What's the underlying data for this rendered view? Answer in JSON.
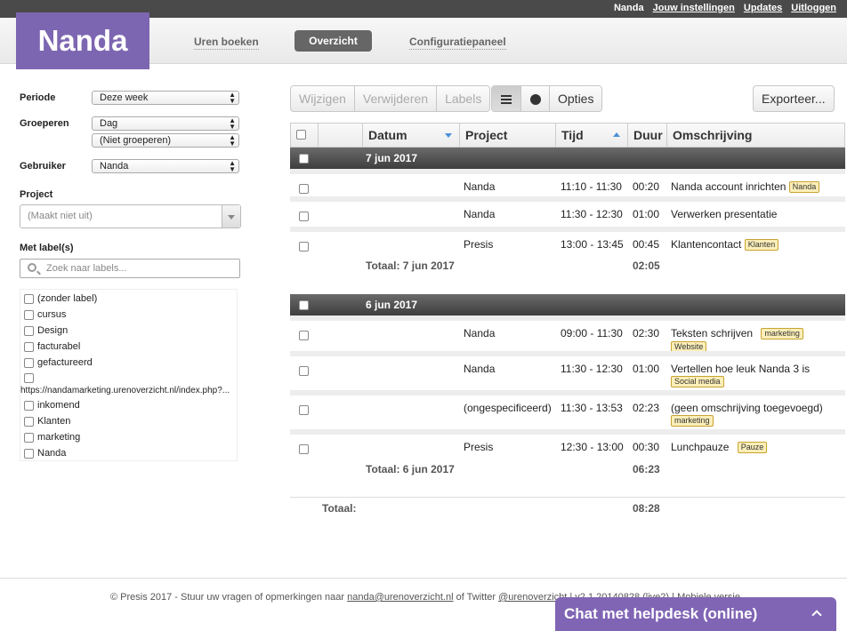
{
  "topbar": {
    "user": "Nanda",
    "settings": "Jouw instellingen",
    "updates": "Updates",
    "logout": "Uitloggen"
  },
  "header": {
    "logo": "Nanda",
    "tabs": [
      "Uren boeken",
      "Overzicht",
      "Configuratiepaneel"
    ],
    "active_tab": "Overzicht"
  },
  "sidebar": {
    "periode_label": "Periode",
    "periode_value": "Deze week",
    "groeperen_label": "Groeperen",
    "groeperen_value": "Dag",
    "groeperen_value2": "(Niet groeperen)",
    "gebruiker_label": "Gebruiker",
    "gebruiker_value": "Nanda",
    "project_label": "Project",
    "project_placeholder": "(Maakt niet uit)",
    "labels_label": "Met label(s)",
    "labels_search_placeholder": "Zoek naar labels...",
    "labels": [
      "(zonder label)",
      "cursus",
      "Design",
      "facturabel",
      "gefactureerd",
      "https://nandamarketing.urenoverzicht.nl/index.php?...",
      "inkomend",
      "Klanten",
      "marketing",
      "Nanda"
    ]
  },
  "toolbar": {
    "edit": "Wijzigen",
    "delete": "Verwijderen",
    "labels": "Labels",
    "options": "Opties",
    "export": "Exporteer..."
  },
  "table": {
    "headers": [
      "Datum",
      "Project",
      "Tijd",
      "Duur",
      "Omschrijving"
    ],
    "groups": [
      {
        "date": "7 jun 2017",
        "rows": [
          {
            "project": "Nanda",
            "time": "11:10 - 11:30",
            "duration": "00:20",
            "description": "Nanda account inrichten",
            "tags": [
              "Nanda"
            ]
          },
          {
            "project": "Nanda",
            "time": "11:30 - 12:30",
            "duration": "01:00",
            "description": "Verwerken presentatie",
            "tags": []
          },
          {
            "project": "Presis",
            "time": "13:00 - 13:45",
            "duration": "00:45",
            "description": "Klantencontact",
            "tags": [
              "Klanten"
            ]
          }
        ],
        "total_label": "Totaal: 7 jun 2017",
        "total": "02:05"
      },
      {
        "date": "6 jun 2017",
        "rows": [
          {
            "project": "Nanda",
            "time": "09:00 - 11:30",
            "duration": "02:30",
            "description": "Teksten schrijven",
            "tags": [
              "marketing",
              "Website"
            ]
          },
          {
            "project": "Nanda",
            "time": "11:30 - 12:30",
            "duration": "01:00",
            "description": "Vertellen hoe leuk Nanda 3 is",
            "tags": [
              "Social media"
            ]
          },
          {
            "project": "(ongespecificeerd)",
            "time": "11:30 - 13:53",
            "duration": "02:23",
            "description": "(geen omschrijving toegevoegd)",
            "tags": [
              "marketing"
            ]
          },
          {
            "project": "Presis",
            "time": "12:30 - 13:00",
            "duration": "00:30",
            "description": "Lunchpauze",
            "tags": [
              "Pauze"
            ]
          }
        ],
        "total_label": "Totaal: 6 jun 2017",
        "total": "06:23"
      }
    ],
    "grand_total_label": "Totaal:",
    "grand_total": "08:28"
  },
  "footer": {
    "prefix": "© Presis 2017 - Stuur uw vragen of opmerkingen naar",
    "email": "nanda@urenoverzicht.nl",
    "mid": "of Twitter",
    "twitter": "@urenoverzicht",
    "version": "| v2.1.20140828 (live2) |",
    "mobile": "Mobiele versie"
  },
  "chat": {
    "label": "Chat met helpdesk (online)"
  }
}
